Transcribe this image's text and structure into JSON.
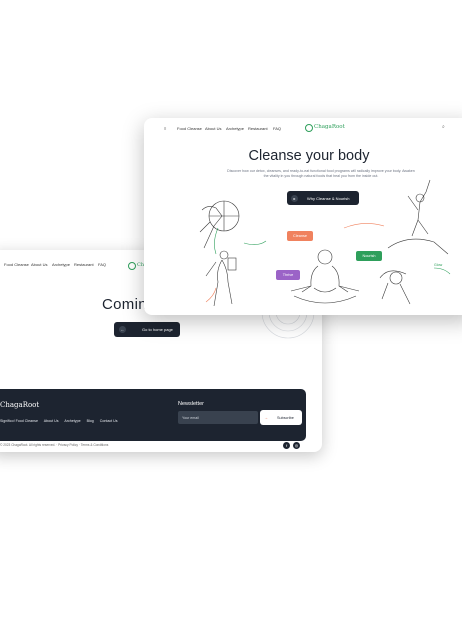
{
  "back_page": {
    "nav": [
      "Food Cleanse",
      "About Us",
      "Archetype",
      "Restaurant",
      "FAQ"
    ],
    "logo_text": "ChagaRoot",
    "heading": "Comin",
    "cta_label": "Go to home page",
    "footer": {
      "logo": "ChagaRoot",
      "links": [
        "Significo! Food Cleanse",
        "About Us",
        "Archetype",
        "Blog",
        "Contact Us"
      ],
      "newsletter_title": "Newsletter",
      "email_placeholder": "Your email",
      "subscribe_label": "Subscribe"
    },
    "copyright": "© 2023 ChagaRoot. All rights reserved. · Privacy Policy · Terms & Conditions"
  },
  "front_page": {
    "nav": [
      "Food Cleanse",
      "About Us",
      "Archetype",
      "Restaurant",
      "FAQ"
    ],
    "logo_text": "ChagaRoot",
    "heading": "Cleanse your body",
    "subtitle": "Discover how our detox, cleanses, and ready-to-eat functional food programs will radically improve your body. Awaken the vitality in you through natural foods that heal you from the inside out.",
    "cta_label": "Why Cleanse & Nourish",
    "tags": {
      "cleanse": "Cleanse",
      "nourish": "Nourish",
      "thrive": "Thrive",
      "glow": "Glow"
    }
  },
  "colors": {
    "dark": "#1d2430",
    "brand_green": "#2e9f5b",
    "cleanse_orange": "#f0825e",
    "nourish_green": "#2e9f5b",
    "thrive_purple": "#9b63c7"
  }
}
